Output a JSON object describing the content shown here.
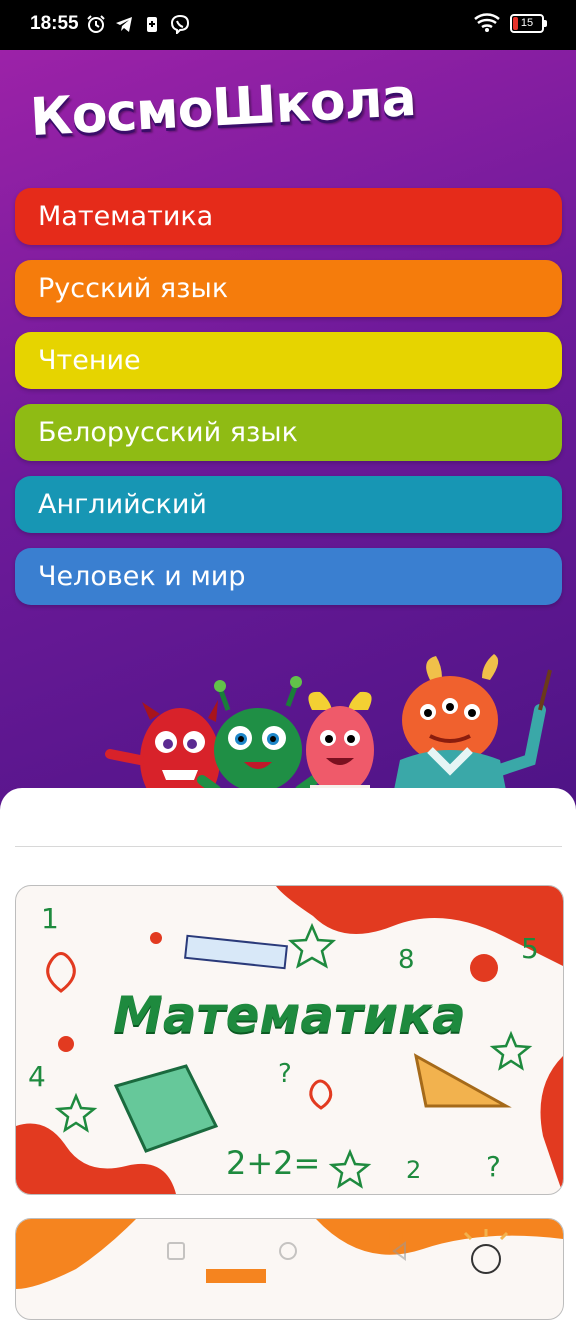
{
  "status_bar": {
    "time": "18:55",
    "battery": "15",
    "icons": [
      "alarm-icon",
      "telegram-icon",
      "battery-saver-icon",
      "viber-icon",
      "wifi-icon"
    ]
  },
  "app": {
    "logo": "КосмоШкола"
  },
  "subjects": [
    {
      "label": "Математика",
      "color": "#e52b1a"
    },
    {
      "label": "Русский язык",
      "color": "#f57c0c"
    },
    {
      "label": "Чтение",
      "color": "#e6d400"
    },
    {
      "label": "Белорусский язык",
      "color": "#8fbb14"
    },
    {
      "label": "Английский",
      "color": "#1796b4"
    },
    {
      "label": "Человек и мир",
      "color": "#3a7fd0"
    }
  ],
  "featured_card": {
    "title": "Математика",
    "decorations": [
      "1",
      "5",
      "8",
      "4",
      "?",
      "2+2=",
      "2",
      "?"
    ]
  },
  "colors": {
    "hero_gradient_start": "#9c22a8",
    "hero_gradient_end": "#4e1486",
    "math_green": "#1e8a3e"
  }
}
